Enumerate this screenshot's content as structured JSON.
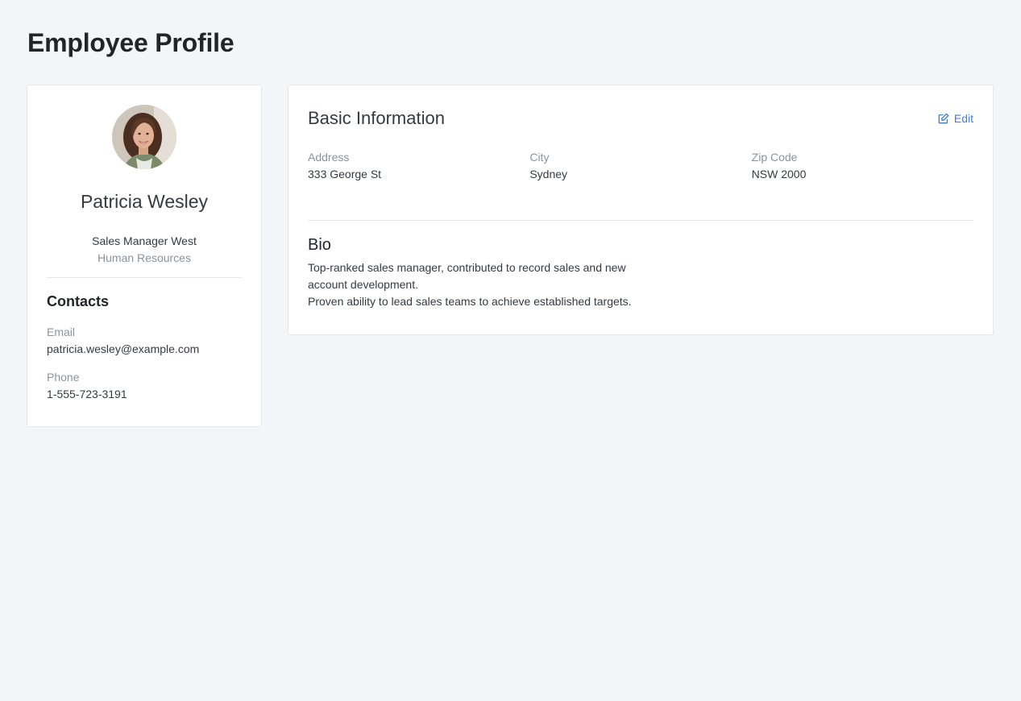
{
  "page": {
    "title": "Employee Profile"
  },
  "profile": {
    "avatar_alt": "Patricia Wesley photo",
    "name": "Patricia Wesley",
    "job_title": "Sales Manager West",
    "department": "Human Resources",
    "contacts_heading": "Contacts",
    "email_label": "Email",
    "email_value": "patricia.wesley@example.com",
    "phone_label": "Phone",
    "phone_value": "1-555-723-3191"
  },
  "basic_info": {
    "title": "Basic Information",
    "edit_label": "Edit",
    "edit_icon": "edit-icon",
    "address_label": "Address",
    "address_value": "333 George St",
    "city_label": "City",
    "city_value": "Sydney",
    "zip_label": "Zip Code",
    "zip_value": "NSW 2000",
    "bio_heading": "Bio",
    "bio_line1": "Top-ranked sales manager, contributed to record sales and new account development.",
    "bio_line2": "Proven ability to lead sales teams to achieve established targets."
  },
  "colors": {
    "background": "#f3f6f9",
    "card": "#ffffff",
    "link": "#3b7dd8",
    "muted": "#8a939c"
  }
}
